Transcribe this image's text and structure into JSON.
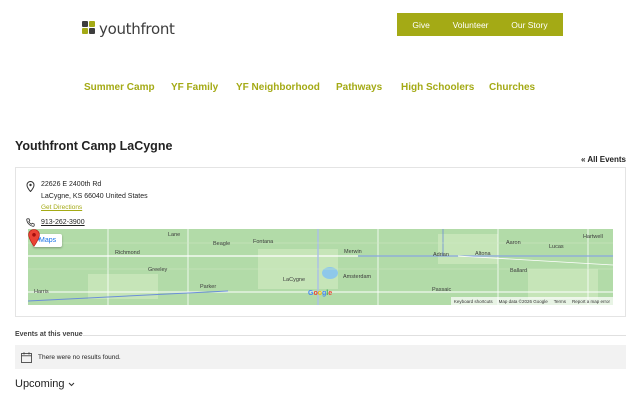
{
  "brand": {
    "logo_text": "youthfront",
    "accent": "#a4aa15"
  },
  "top_nav": [
    "Give",
    "Volunteer",
    "Our Story"
  ],
  "main_nav": [
    "Summer Camp",
    "YF Family",
    "YF Neighborhood",
    "Pathways",
    "High Schoolers",
    "Churches"
  ],
  "venue": {
    "title": "Youthfront Camp LaCygne",
    "all_events_link": "« All Events",
    "address_line1": "22626 E 2400th Rd",
    "address_line2": "LaCygne, KS 66040 United States",
    "directions_link": "Get Directions",
    "phone": "913-262-3900"
  },
  "map": {
    "maps_button": "Maps",
    "labels": [
      "Lane",
      "Beagle",
      "Fontana",
      "Richmond",
      "Greeley",
      "Parker",
      "LaCygne",
      "Harris",
      "Merwin",
      "Amsterdam",
      "Adrian",
      "Altona",
      "Aaron",
      "Lucas",
      "Hartwell",
      "Ballard",
      "Passaic"
    ],
    "google": "Google",
    "footer": [
      "Keyboard shortcuts",
      "Map data ©2026 Google",
      "Terms",
      "Report a map error"
    ]
  },
  "events": {
    "heading": "Events at this venue",
    "no_results": "There were no results found.",
    "upcoming": "Upcoming"
  }
}
